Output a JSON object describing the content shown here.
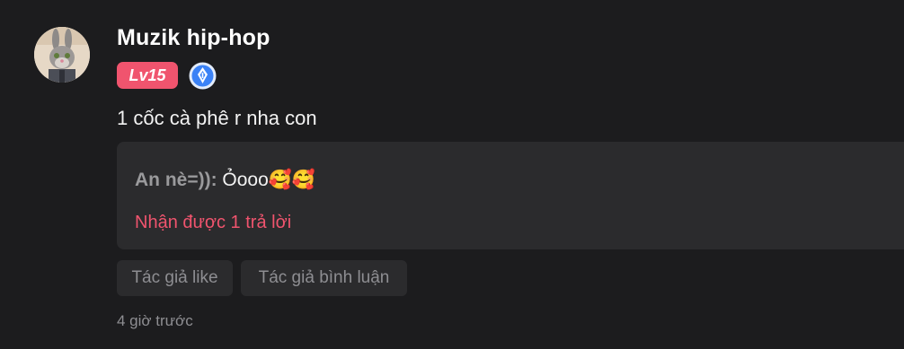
{
  "comment": {
    "username": "Muzik hip-hop",
    "level_badge": "Lv15",
    "verified_icon": "blue-crest-icon",
    "text": "1 cốc cà phê r nha con",
    "reply_preview": {
      "author": "An nè=)):",
      "text": " Ỏooo🥰🥰",
      "reply_count_text": "Nhận được 1 trả lời"
    },
    "tags": {
      "author_like": "Tác giả like",
      "author_comment": "Tác giả bình luận"
    },
    "timestamp": "4 giờ trước"
  },
  "colors": {
    "background": "#1c1c1e",
    "card": "#2b2b2d",
    "accent": "#f0546e",
    "verified_blue": "#3b82f6"
  }
}
